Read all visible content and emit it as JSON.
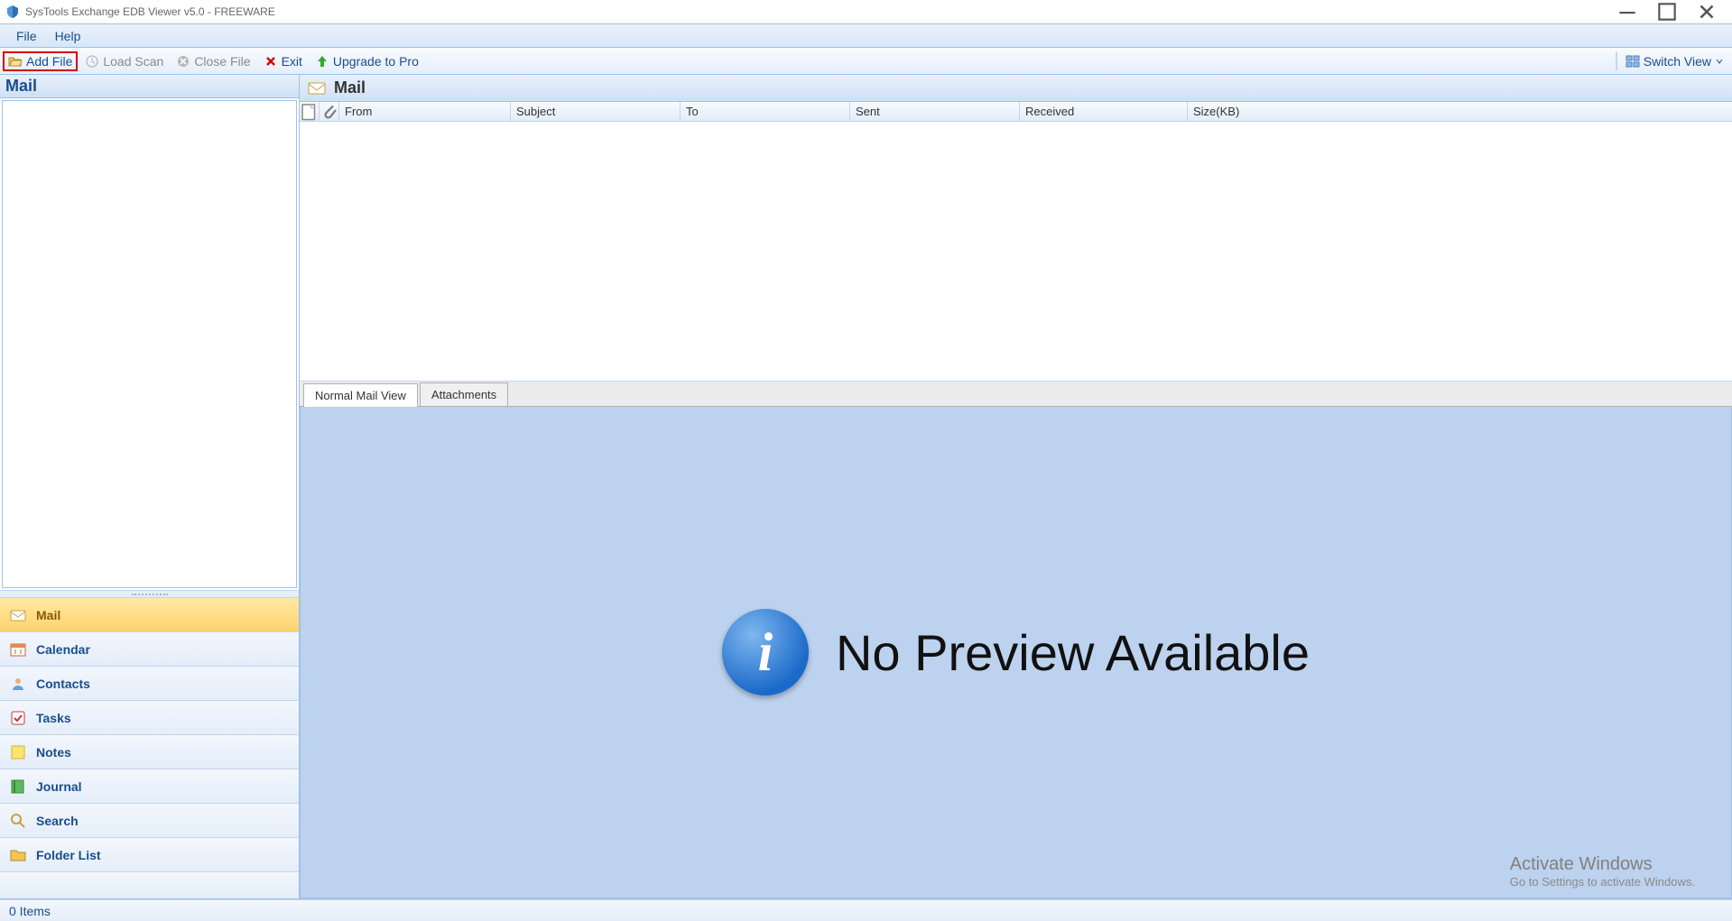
{
  "window": {
    "title": "SysTools Exchange EDB Viewer v5.0 - FREEWARE"
  },
  "menubar": {
    "file": "File",
    "help": "Help"
  },
  "toolbar": {
    "add_file": "Add File",
    "load_scan": "Load Scan",
    "close_file": "Close File",
    "exit": "Exit",
    "upgrade": "Upgrade to Pro",
    "switch_view": "Switch View"
  },
  "left": {
    "header": "Mail",
    "nav": {
      "mail": "Mail",
      "calendar": "Calendar",
      "contacts": "Contacts",
      "tasks": "Tasks",
      "notes": "Notes",
      "journal": "Journal",
      "search": "Search",
      "folder_list": "Folder List"
    }
  },
  "right": {
    "header": "Mail",
    "columns": {
      "from": "From",
      "subject": "Subject",
      "to": "To",
      "sent": "Sent",
      "received": "Received",
      "size": "Size(KB)"
    },
    "tabs": {
      "normal": "Normal Mail View",
      "attachments": "Attachments"
    },
    "preview": {
      "message": "No Preview Available"
    }
  },
  "status": {
    "items": "0 Items"
  },
  "watermark": {
    "line1": "Activate Windows",
    "line2": "Go to Settings to activate Windows."
  }
}
